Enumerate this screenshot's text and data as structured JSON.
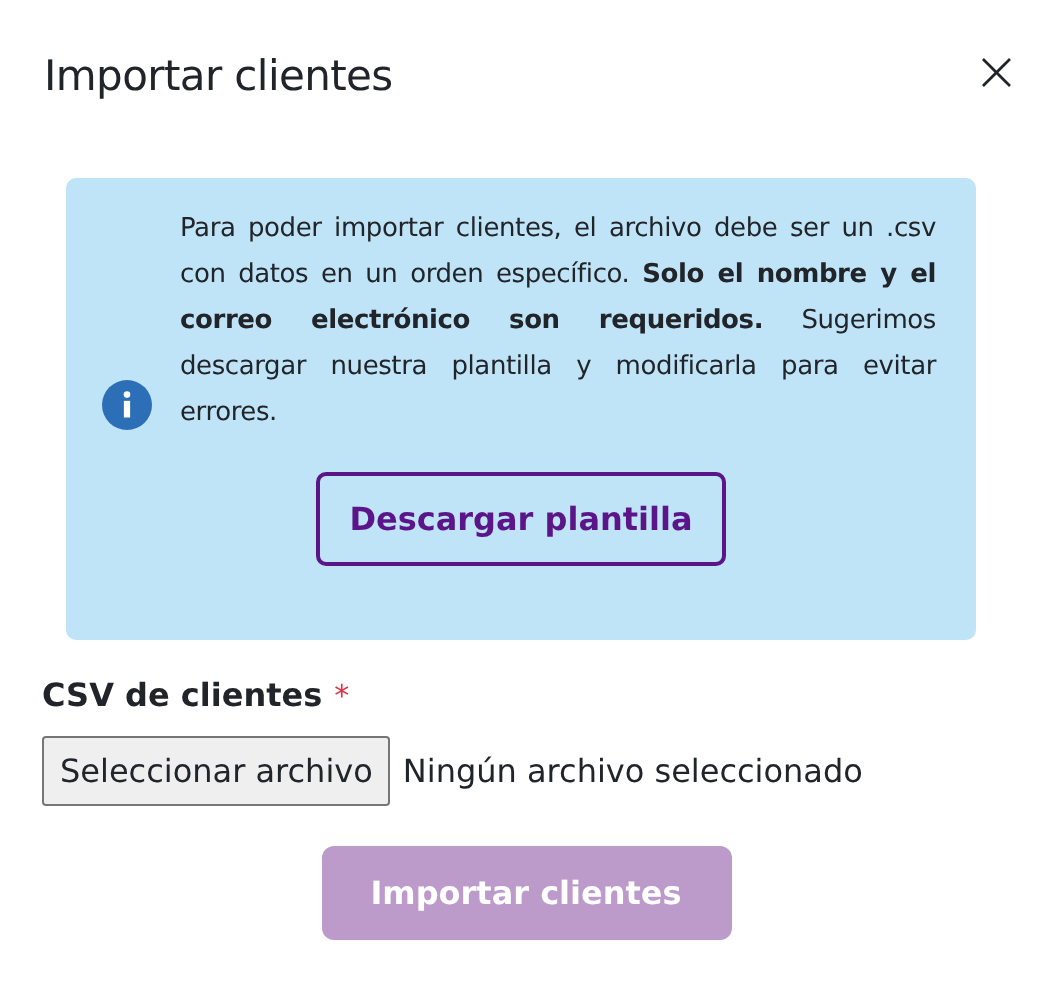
{
  "dialog": {
    "title": "Importar clientes",
    "close": "×"
  },
  "info": {
    "text": "Para poder importar clientes, el archivo debe ser un .csv con datos en un orden específico. **Solo el nombre y el correo electrónico son requeridos.** Sugerimos descargar nuestra plantilla y modificarla para evitar errores.",
    "button": "Descargar plantilla"
  },
  "field": {
    "label": "CSV de clientes",
    "required_mark": "*",
    "button": "Seleccionar archivo",
    "status": "Ningún archivo seleccionado"
  },
  "submit": {
    "label": "Importar clientes",
    "disabled": true
  }
}
